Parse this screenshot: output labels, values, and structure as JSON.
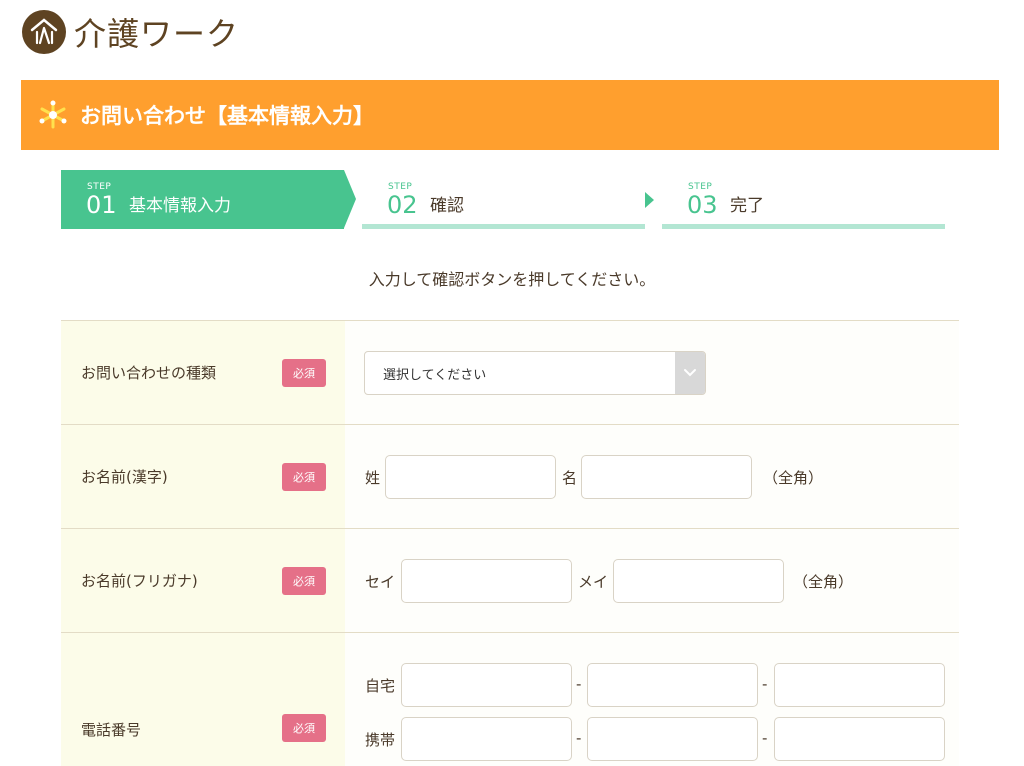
{
  "logo": {
    "text": "介護ワーク"
  },
  "banner": {
    "title": "お問い合わせ【基本情報入力】"
  },
  "steps": [
    {
      "small": "STEP",
      "num": "01",
      "label": "基本情報入力"
    },
    {
      "small": "STEP",
      "num": "02",
      "label": "確認"
    },
    {
      "small": "STEP",
      "num": "03",
      "label": "完了"
    }
  ],
  "instruction": "入力して確認ボタンを押してください。",
  "form": {
    "required_label": "必須",
    "inquiry_type": {
      "label": "お問い合わせの種類",
      "selected": "選択してください"
    },
    "name_kanji": {
      "label": "お名前(漢字)",
      "last_label": "姓",
      "first_label": "名",
      "note": "（全角）"
    },
    "name_kana": {
      "label": "お名前(フリガナ)",
      "last_label": "セイ",
      "first_label": "メイ",
      "note": "（全角）"
    },
    "phone": {
      "label": "電話番号",
      "home_label": "自宅",
      "mobile_label": "携帯",
      "separator": "-"
    }
  }
}
